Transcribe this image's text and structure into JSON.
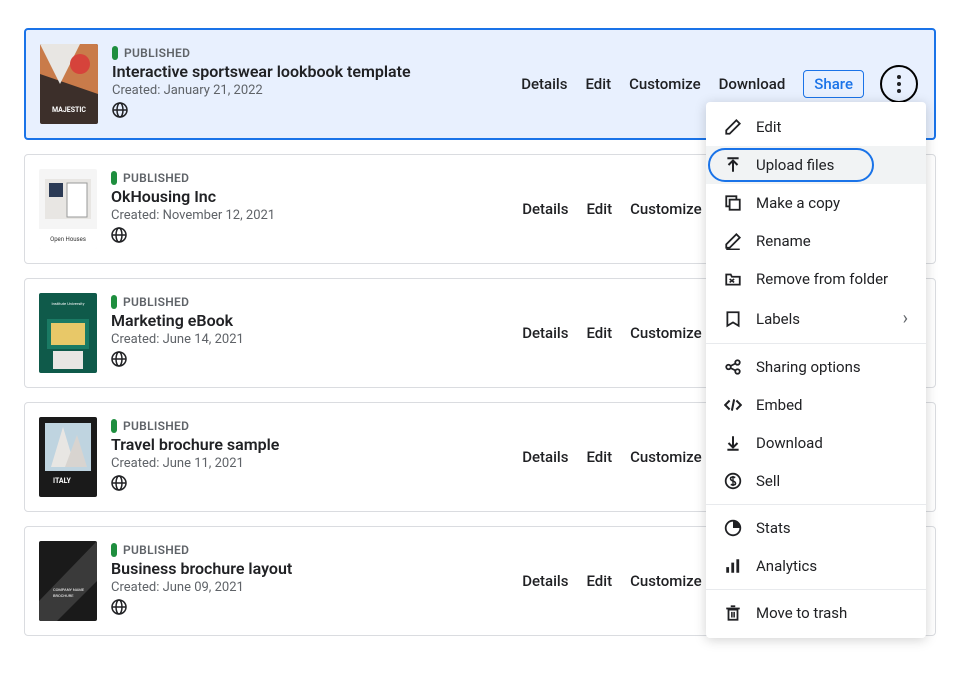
{
  "status_label": "PUBLISHED",
  "created_prefix": "Created: ",
  "actions": {
    "details": "Details",
    "edit": "Edit",
    "customize": "Customize",
    "download": "Download",
    "share": "Share"
  },
  "items": [
    {
      "title": "Interactive sportswear lookbook template",
      "created": "January 21, 2022",
      "selected": true,
      "thumb": "majestic"
    },
    {
      "title": "OkHousing Inc",
      "created": "November 12, 2021",
      "selected": false,
      "thumb": "house"
    },
    {
      "title": "Marketing eBook",
      "created": "June 14, 2021",
      "selected": false,
      "thumb": "ebook"
    },
    {
      "title": "Travel brochure sample",
      "created": "June 11, 2021",
      "selected": false,
      "thumb": "italy"
    },
    {
      "title": "Business brochure layout",
      "created": "June 09, 2021",
      "selected": false,
      "thumb": "biz"
    }
  ],
  "menu": [
    {
      "icon": "edit-icon",
      "label": "Edit"
    },
    {
      "icon": "upload-icon",
      "label": "Upload files",
      "highlight": true
    },
    {
      "icon": "copy-icon",
      "label": "Make a copy"
    },
    {
      "icon": "rename-icon",
      "label": "Rename"
    },
    {
      "icon": "remove-folder-icon",
      "label": "Remove from folder"
    },
    {
      "icon": "labels-icon",
      "label": "Labels",
      "submenu": true
    },
    {
      "sep": true
    },
    {
      "icon": "share-icon",
      "label": "Sharing options"
    },
    {
      "icon": "embed-icon",
      "label": "Embed"
    },
    {
      "icon": "download-icon",
      "label": "Download"
    },
    {
      "icon": "sell-icon",
      "label": "Sell"
    },
    {
      "sep": true
    },
    {
      "icon": "stats-icon",
      "label": "Stats"
    },
    {
      "icon": "analytics-icon",
      "label": "Analytics"
    },
    {
      "sep": true
    },
    {
      "icon": "trash-icon",
      "label": "Move to trash"
    }
  ]
}
